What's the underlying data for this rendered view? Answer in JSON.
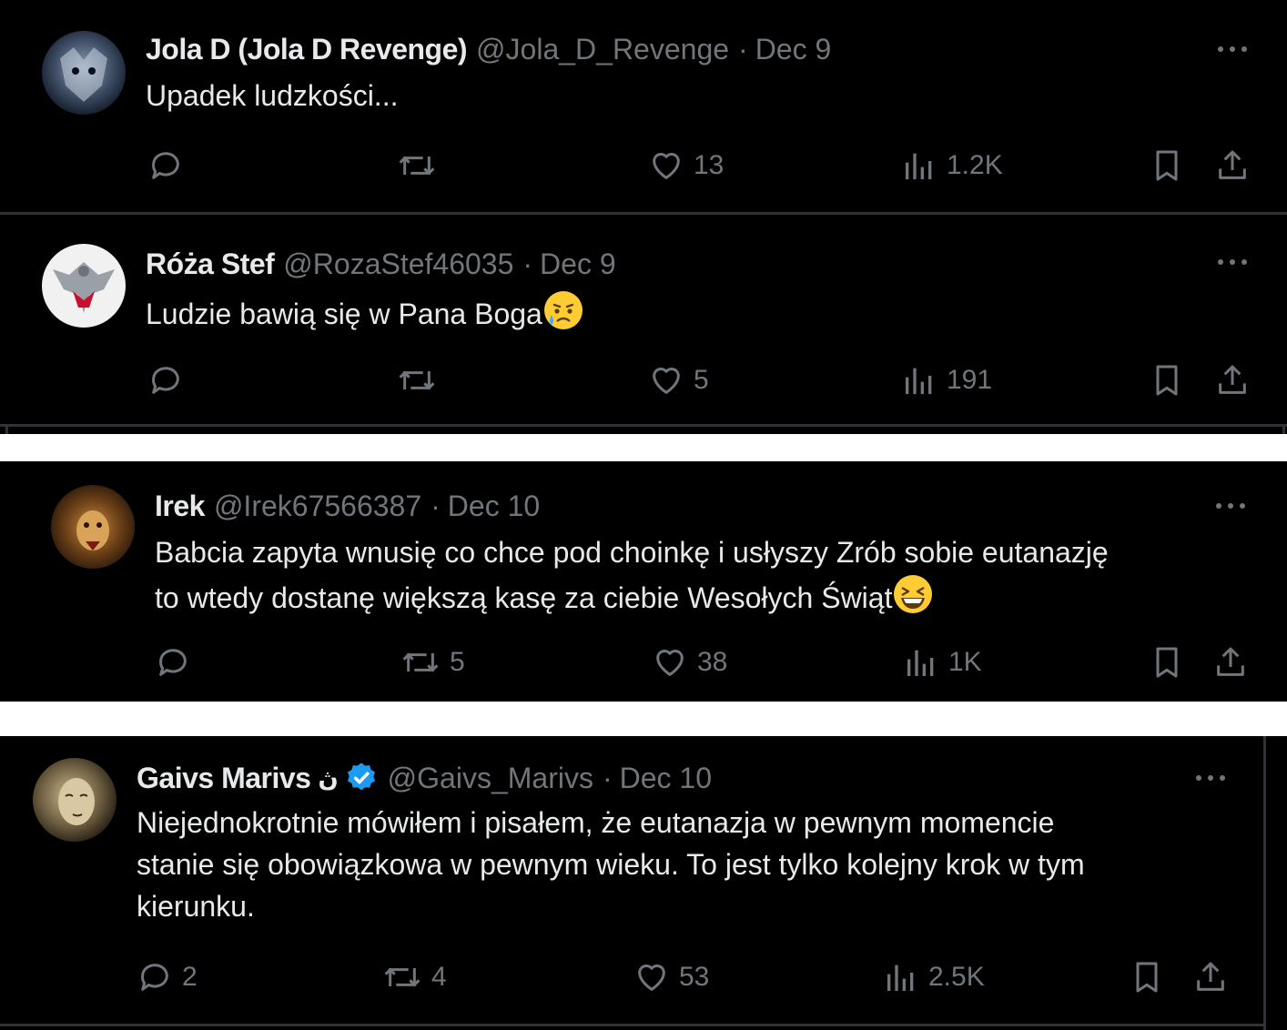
{
  "tweets": [
    {
      "name": "Jola D (Jola D Revenge)",
      "handle": "@Jola_D_Revenge",
      "sep": "·",
      "date": "Dec 9",
      "text": "Upadek ludzkości...",
      "reply_count": "",
      "repost_count": "",
      "like_count": "13",
      "view_count": "1.2K"
    },
    {
      "name": "Róża Stef",
      "handle": "@RozaStef46035",
      "sep": "·",
      "date": "Dec 9",
      "text": "Ludzie bawią się w Pana Boga",
      "emoji": "sad-relieved-face-emoji",
      "reply_count": "",
      "repost_count": "",
      "like_count": "5",
      "view_count": "191"
    },
    {
      "name": "Irek",
      "handle": "@Irek67566387",
      "sep": "·",
      "date": "Dec 10",
      "text_line1": "Babcia zapyta wnusię co chce pod choinkę i usłyszy Zrób sobie eutanazję",
      "text_line2": "to wtedy dostanę większą kasę za ciebie Wesołych Świąt",
      "emoji": "grinning-squinting-face-emoji",
      "reply_count": "",
      "repost_count": "5",
      "like_count": "38",
      "view_count": "1K"
    },
    {
      "name": "Gaivs Marivs",
      "name_suffix": "ڽ",
      "verified": true,
      "handle": "@Gaivs_Marivs",
      "sep": "·",
      "date": "Dec 10",
      "text_line1": "Niejednokrotnie mówiłem i pisałem, że eutanazja w pewnym momencie",
      "text_line2": "stanie się obowiązkowa w pewnym wieku. To jest tylko kolejny krok w tym",
      "text_line3": "kierunku.",
      "reply_count": "2",
      "repost_count": "4",
      "like_count": "53",
      "view_count": "2.5K"
    }
  ],
  "colors": {
    "background": "#000000",
    "text": "#e7e9ea",
    "secondary": "#71767b",
    "divider": "#2f3336",
    "verified": "#1d9bf0"
  }
}
